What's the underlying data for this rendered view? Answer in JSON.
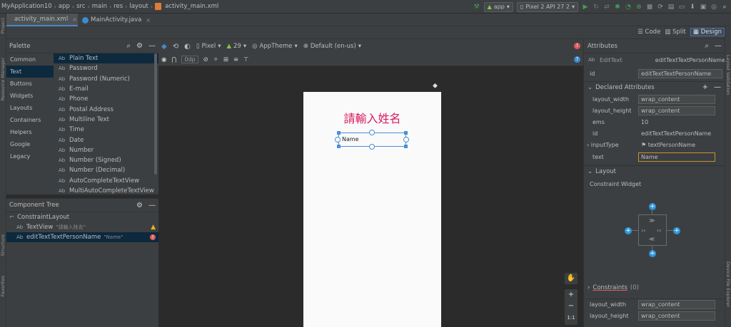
{
  "breadcrumb": {
    "project": "MyApplication10",
    "parts": [
      "app",
      "src",
      "main",
      "res",
      "layout"
    ],
    "file": "activity_main.xml"
  },
  "run": {
    "config": "app",
    "device": "Pixel 2 API 27 2"
  },
  "editor_tabs": [
    {
      "label": "activity_main.xml",
      "icon": "xml-file-icon"
    },
    {
      "label": "MainActivity.java",
      "icon": "java-class-icon"
    }
  ],
  "view_modes": {
    "code": "Code",
    "split": "Split",
    "design": "Design"
  },
  "side_tools": {
    "project": "Project",
    "resource_manager": "Resource Manager",
    "structure": "Structure",
    "favorites": "Favorites",
    "layout_validation": "Layout Validation",
    "device_file_explorer": "Device File Explorer"
  },
  "palette": {
    "title": "Palette",
    "categories": [
      "Common",
      "Text",
      "Buttons",
      "Widgets",
      "Layouts",
      "Containers",
      "Helpers",
      "Google",
      "Legacy"
    ],
    "selected_category": "Text",
    "items": [
      "Plain Text",
      "Password",
      "Password (Numeric)",
      "E-mail",
      "Phone",
      "Postal Address",
      "Multiline Text",
      "Time",
      "Date",
      "Number",
      "Number (Signed)",
      "Number (Decimal)",
      "AutoCompleteTextView",
      "MultiAutoCompleteTextView"
    ],
    "ab_badge": "Ab"
  },
  "component_tree": {
    "title": "Component Tree",
    "root": "ConstraintLayout",
    "children": [
      {
        "name": "TextView",
        "hint": "\"請輸入姓名\""
      },
      {
        "name": "editTextTextPersonName",
        "hint": "\"Name\""
      }
    ]
  },
  "design_toolbar": {
    "device": "Pixel",
    "api": "29",
    "theme": "AppTheme",
    "locale": "Default (en-us)",
    "margin": "0dp"
  },
  "preview": {
    "headline": "請輸入姓名",
    "edit_text": "Name",
    "headline_color": "#d81b60"
  },
  "zoom": {
    "plus": "+",
    "minus": "−",
    "ratio": "1:1"
  },
  "attributes": {
    "title": "Attributes",
    "widget_type": "EditText",
    "widget_id": "editTextTextPersonName",
    "id_label": "id",
    "id_value": "editTextTextPersonName",
    "declared_title": "Declared Attributes",
    "declared": [
      {
        "key": "layout_width",
        "value": "wrap_content"
      },
      {
        "key": "layout_height",
        "value": "wrap_content"
      },
      {
        "key": "ems",
        "value": "10"
      },
      {
        "key": "id",
        "value": "editTextTextPersonName"
      },
      {
        "key": "inputType",
        "value": "textPersonName"
      },
      {
        "key": "text",
        "value": "Name"
      }
    ],
    "layout_title": "Layout",
    "constraint_widget": "Constraint Widget",
    "constraints_label": "Constraints",
    "constraints_count": "(0)",
    "bottom_rows": [
      {
        "key": "layout_width",
        "value": "wrap_content"
      },
      {
        "key": "layout_height",
        "value": "wrap_content"
      }
    ]
  },
  "colors": {
    "accent": "#4a88c7",
    "selection": "#0d293e",
    "run_green": "#499c54",
    "error": "#db5c5c",
    "warning": "#e5b32a"
  }
}
